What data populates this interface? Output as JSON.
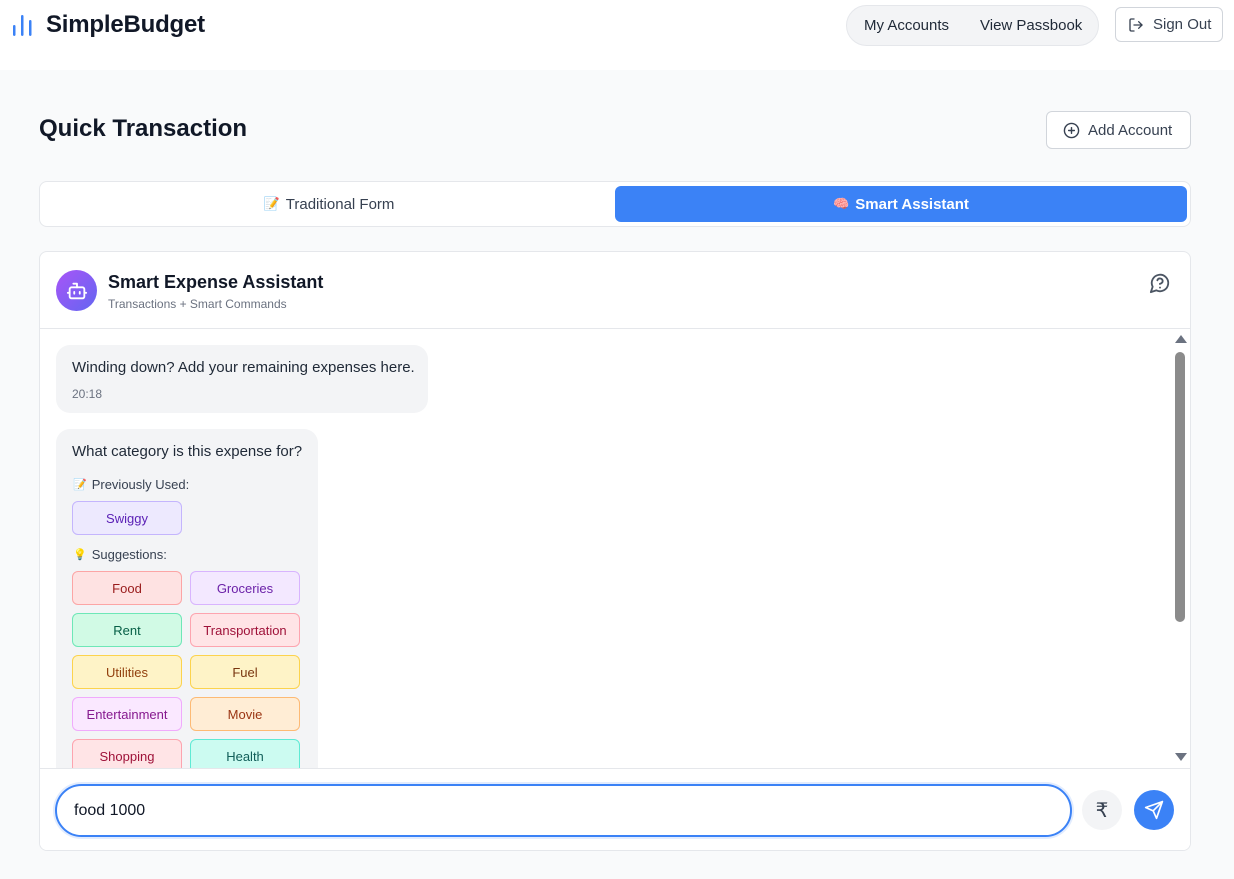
{
  "app": {
    "name": "SimpleBudget",
    "logo_icon": "bar-chart-icon",
    "accent": "#3b82f6"
  },
  "nav": {
    "my_accounts": "My Accounts",
    "view_passbook": "View Passbook",
    "sign_out": "Sign Out"
  },
  "page": {
    "title": "Quick Transaction",
    "add_account": "Add Account"
  },
  "tabs": [
    {
      "label": "Traditional Form",
      "emoji": "📝",
      "active": false
    },
    {
      "label": "Smart Assistant",
      "emoji": "🧠",
      "active": true
    }
  ],
  "assistant": {
    "title": "Smart Expense Assistant",
    "subtitle": "Transactions + Smart Commands",
    "avatar_icon": "robot-icon",
    "help_icon": "chat-help-icon"
  },
  "messages": [
    {
      "text": "Winding down? Add your remaining expenses here.",
      "time": "20:18"
    },
    {
      "text": "What category is this expense for?",
      "previously_used_label": "Previously Used:",
      "previously_used_emoji": "📝",
      "previously_used": [
        "Swiggy"
      ],
      "suggestions_label": "Suggestions:",
      "suggestions_emoji": "💡",
      "suggestions": [
        "Food",
        "Groceries",
        "Rent",
        "Transportation",
        "Utilities",
        "Fuel",
        "Entertainment",
        "Movie",
        "Shopping",
        "Health"
      ]
    }
  ],
  "composer": {
    "value": "food 1000",
    "rupee_symbol": "₹",
    "send_icon": "send-icon"
  },
  "chip_colors": {
    "Swiggy": [
      "#ede9fe",
      "#c4b5fd",
      "#5b21b6"
    ],
    "Food": [
      "#fee2e2",
      "#fca5a5",
      "#991b1b"
    ],
    "Groceries": [
      "#f3e8ff",
      "#d8b4fe",
      "#6b21a8"
    ],
    "Rent": [
      "#d1fae5",
      "#6ee7b7",
      "#065f46"
    ],
    "Transportation": [
      "#ffe4e6",
      "#fda4af",
      "#9f1239"
    ],
    "Utilities": [
      "#fef3c7",
      "#fcd34d",
      "#92400e"
    ],
    "Fuel": [
      "#fef3c7",
      "#fcd34d",
      "#78350f"
    ],
    "Entertainment": [
      "#fae8ff",
      "#f0abfc",
      "#86198f"
    ],
    "Movie": [
      "#ffedd5",
      "#fdba74",
      "#9a3412"
    ],
    "Shopping": [
      "#ffe4e6",
      "#fda4af",
      "#9f1239"
    ],
    "Health": [
      "#ccfbf1",
      "#5eead4",
      "#115e59"
    ]
  }
}
